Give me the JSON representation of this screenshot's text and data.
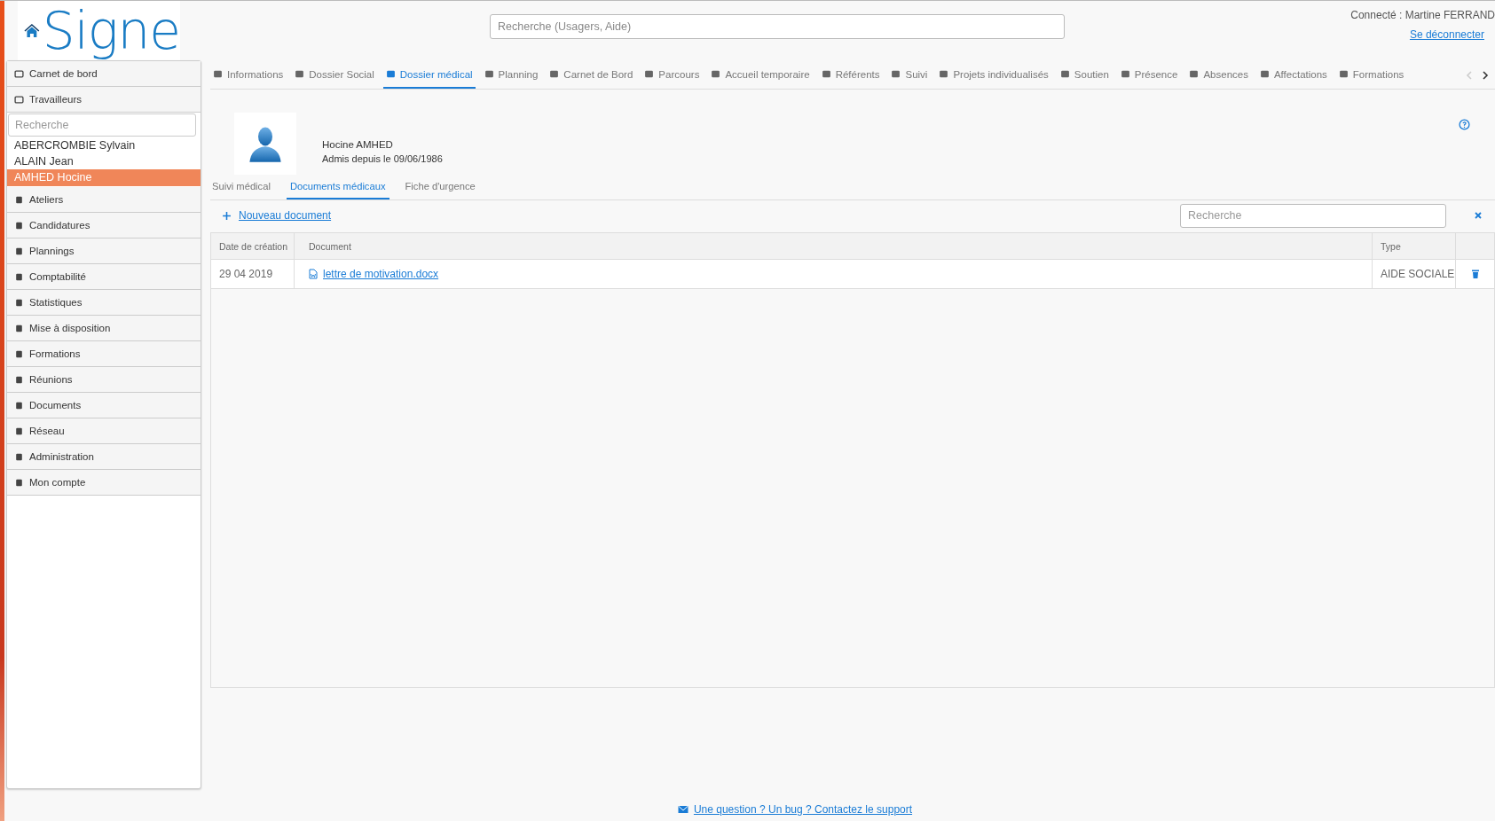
{
  "logo": {
    "text": "Signe"
  },
  "search": {
    "placeholder": "Recherche (Usagers, Aide)"
  },
  "user": {
    "connected": "Connecté : Martine FERRAND",
    "logout": "Se déconnecter"
  },
  "sidebar": {
    "top_items": [
      "Carnet de bord",
      "Travailleurs"
    ],
    "search": {
      "placeholder": "Recherche"
    },
    "people": [
      {
        "label": "ABERCROMBIE Sylvain",
        "selected": false
      },
      {
        "label": "ALAIN Jean",
        "selected": false
      },
      {
        "label": "AMHED Hocine",
        "selected": true
      }
    ],
    "bottom_items": [
      "Ateliers",
      "Candidatures",
      "Plannings",
      "Comptabilité",
      "Statistiques",
      "Mise à disposition",
      "Formations",
      "Réunions",
      "Documents",
      "Réseau",
      "Administration",
      "Mon compte"
    ]
  },
  "tabs": [
    {
      "label": "Informations",
      "selected": false
    },
    {
      "label": "Dossier Social",
      "selected": false
    },
    {
      "label": "Dossier médical",
      "selected": true
    },
    {
      "label": "Planning",
      "selected": false
    },
    {
      "label": "Carnet de Bord",
      "selected": false
    },
    {
      "label": "Parcours",
      "selected": false
    },
    {
      "label": "Accueil temporaire",
      "selected": false
    },
    {
      "label": "Référents",
      "selected": false
    },
    {
      "label": "Suivi",
      "selected": false
    },
    {
      "label": "Projets individualisés",
      "selected": false
    },
    {
      "label": "Soutien",
      "selected": false
    },
    {
      "label": "Présence",
      "selected": false
    },
    {
      "label": "Absences",
      "selected": false
    },
    {
      "label": "Affectations",
      "selected": false
    },
    {
      "label": "Formations",
      "selected": false
    }
  ],
  "profile": {
    "name": "Hocine AMHED",
    "admitted": "Admis depuis le 09/06/1986"
  },
  "subtabs": [
    {
      "label": "Suivi médical",
      "selected": false
    },
    {
      "label": "Documents médicaux",
      "selected": true
    },
    {
      "label": "Fiche d'urgence",
      "selected": false
    }
  ],
  "new_document": "Nouveau document",
  "doc_search": {
    "placeholder": "Recherche"
  },
  "table": {
    "columns": [
      "Date de création",
      "Document",
      "Type"
    ],
    "rows": [
      {
        "date": "29 04 2019",
        "document": "lettre de motivation.docx",
        "type": "AIDE SOCIALE"
      }
    ]
  },
  "footer": {
    "link": "Une question ? Un bug ? Contactez le support"
  }
}
